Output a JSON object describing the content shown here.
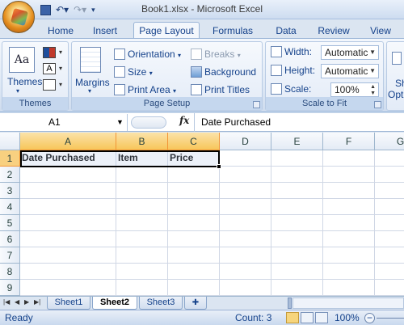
{
  "window": {
    "title": "Book1.xlsx - Microsoft Excel"
  },
  "tabs": [
    "Home",
    "Insert",
    "Page Layout",
    "Formulas",
    "Data",
    "Review",
    "View"
  ],
  "active_tab": "Page Layout",
  "ribbon": {
    "themes": {
      "themes_label": "Themes",
      "group_label": "Themes"
    },
    "page_setup": {
      "margins_label": "Margins",
      "orientation_label": "Orientation",
      "size_label": "Size",
      "print_area_label": "Print Area",
      "breaks_label": "Breaks",
      "background_label": "Background",
      "print_titles_label": "Print Titles",
      "group_label": "Page Setup"
    },
    "scale_to_fit": {
      "width_label": "Width:",
      "width_value": "Automatic",
      "height_label": "Height:",
      "height_value": "Automatic",
      "scale_label": "Scale:",
      "scale_value": "100%",
      "group_label": "Scale to Fit"
    },
    "sheet_options": {
      "partial_label": "Sh",
      "partial_label2": "Opti"
    }
  },
  "formula_bar": {
    "name_box": "A1",
    "fx": "fx",
    "value": "Date Purchased"
  },
  "grid": {
    "columns": [
      "A",
      "B",
      "C",
      "D",
      "E",
      "F",
      "G"
    ],
    "rows": [
      "1",
      "2",
      "3",
      "4",
      "5",
      "6",
      "7",
      "8",
      "9"
    ],
    "row1": [
      "Date Purchased",
      "Item",
      "Price"
    ]
  },
  "sheets": [
    "Sheet1",
    "Sheet2",
    "Sheet3"
  ],
  "active_sheet": "Sheet2",
  "status": {
    "ready": "Ready",
    "count": "Count: 3",
    "zoom": "100%"
  },
  "colors": {
    "selection_header": "#f7c65a",
    "ribbon_text": "#15428b"
  }
}
